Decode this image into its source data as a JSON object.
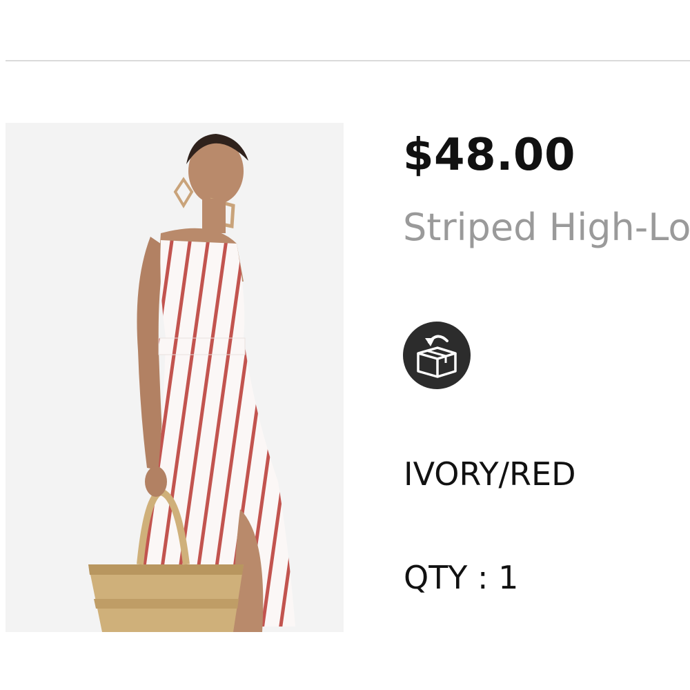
{
  "product": {
    "price": "$48.00",
    "name": "Striped High-Lo",
    "color": "IVORY/RED",
    "quantity": "QTY : 1",
    "image_icon": "product-photo-striped-dress",
    "return_icon": "box-return-icon"
  },
  "colors": {
    "divider": "#dadada",
    "price_text": "#111111",
    "name_text": "#9a9a9a",
    "badge": "#2c2c2c"
  }
}
